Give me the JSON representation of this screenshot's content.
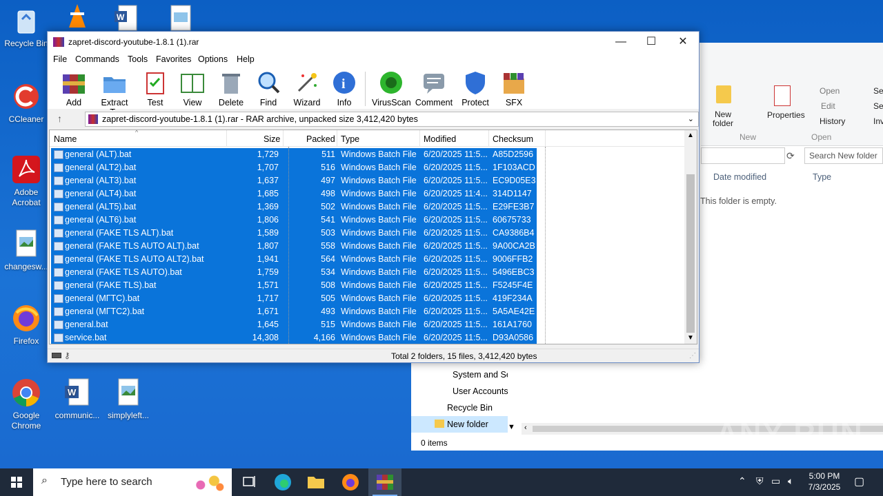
{
  "desktop": {
    "icons": [
      {
        "label": "Recycle Bin"
      },
      {
        "label": "CCleaner"
      },
      {
        "label": "Adobe Acrobat"
      },
      {
        "label": "changesw..."
      },
      {
        "label": "Firefox"
      },
      {
        "label": "Google Chrome"
      },
      {
        "label": "communic..."
      },
      {
        "label": "simplyleft..."
      }
    ]
  },
  "explorer": {
    "ribbon": {
      "new_folder": "New folder",
      "new_group": "New",
      "properties": "Properties",
      "open": "Open",
      "edit": "Edit",
      "history": "History",
      "open_group": "Open",
      "sel1": "Sel",
      "sel2": "Sel",
      "inv": "Inv"
    },
    "search_placeholder": "Search New folder",
    "col_date": "Date modified",
    "col_type": "Type",
    "empty_msg": "This folder is empty.",
    "nav": [
      {
        "label": "System and Se"
      },
      {
        "label": "User Accounts"
      },
      {
        "label": "Recycle Bin"
      },
      {
        "label": "New folder"
      }
    ],
    "status": "0 items"
  },
  "winrar": {
    "title": "zapret-discord-youtube-1.8.1 (1).rar",
    "menu": [
      "File",
      "Commands",
      "Tools",
      "Favorites",
      "Options",
      "Help"
    ],
    "toolbar": [
      "Add",
      "Extract To",
      "Test",
      "View",
      "Delete",
      "Find",
      "Wizard",
      "Info",
      "VirusScan",
      "Comment",
      "Protect",
      "SFX"
    ],
    "address": "zapret-discord-youtube-1.8.1 (1).rar - RAR archive, unpacked size 3,412,420 bytes",
    "columns": {
      "name": "Name",
      "size": "Size",
      "packed": "Packed",
      "type": "Type",
      "modified": "Modified",
      "checksum": "Checksum"
    },
    "files": [
      {
        "name": "general (ALT).bat",
        "size": "1,729",
        "packed": "511",
        "type": "Windows Batch File",
        "modified": "6/20/2025 11:5...",
        "checksum": "A85D2596"
      },
      {
        "name": "general (ALT2).bat",
        "size": "1,707",
        "packed": "516",
        "type": "Windows Batch File",
        "modified": "6/20/2025 11:5...",
        "checksum": "1F103ACD"
      },
      {
        "name": "general (ALT3).bat",
        "size": "1,637",
        "packed": "497",
        "type": "Windows Batch File",
        "modified": "6/20/2025 11:5...",
        "checksum": "EC9D05E3"
      },
      {
        "name": "general (ALT4).bat",
        "size": "1,685",
        "packed": "498",
        "type": "Windows Batch File",
        "modified": "6/20/2025 11:4...",
        "checksum": "314D1147"
      },
      {
        "name": "general (ALT5).bat",
        "size": "1,369",
        "packed": "502",
        "type": "Windows Batch File",
        "modified": "6/20/2025 11:5...",
        "checksum": "E29FE3B7"
      },
      {
        "name": "general (ALT6).bat",
        "size": "1,806",
        "packed": "541",
        "type": "Windows Batch File",
        "modified": "6/20/2025 11:5...",
        "checksum": "60675733"
      },
      {
        "name": "general (FAKE TLS ALT).bat",
        "size": "1,589",
        "packed": "503",
        "type": "Windows Batch File",
        "modified": "6/20/2025 11:5...",
        "checksum": "CA9386B4"
      },
      {
        "name": "general (FAKE TLS AUTO ALT).bat",
        "size": "1,807",
        "packed": "558",
        "type": "Windows Batch File",
        "modified": "6/20/2025 11:5...",
        "checksum": "9A00CA2B"
      },
      {
        "name": "general (FAKE TLS AUTO ALT2).bat",
        "size": "1,941",
        "packed": "564",
        "type": "Windows Batch File",
        "modified": "6/20/2025 11:5...",
        "checksum": "9006FFB2"
      },
      {
        "name": "general (FAKE TLS AUTO).bat",
        "size": "1,759",
        "packed": "534",
        "type": "Windows Batch File",
        "modified": "6/20/2025 11:5...",
        "checksum": "5496EBC3"
      },
      {
        "name": "general (FAKE TLS).bat",
        "size": "1,571",
        "packed": "508",
        "type": "Windows Batch File",
        "modified": "6/20/2025 11:5...",
        "checksum": "F5245F4E"
      },
      {
        "name": "general (МГТС).bat",
        "size": "1,717",
        "packed": "505",
        "type": "Windows Batch File",
        "modified": "6/20/2025 11:5...",
        "checksum": "419F234A"
      },
      {
        "name": "general (МГТС2).bat",
        "size": "1,671",
        "packed": "493",
        "type": "Windows Batch File",
        "modified": "6/20/2025 11:5...",
        "checksum": "5A5AE42E"
      },
      {
        "name": "general.bat",
        "size": "1,645",
        "packed": "515",
        "type": "Windows Batch File",
        "modified": "6/20/2025 11:5...",
        "checksum": "161A1760"
      },
      {
        "name": "service.bat",
        "size": "14,308",
        "packed": "4,166",
        "type": "Windows Batch File",
        "modified": "6/20/2025 11:5...",
        "checksum": "D93A0586"
      }
    ],
    "status": "Total 2 folders, 15 files, 3,412,420 bytes"
  },
  "taskbar": {
    "search_placeholder": "Type here to search",
    "time": "5:00 PM",
    "date": "7/3/2025"
  },
  "watermark": "ANY RUN",
  "colors": {
    "selection": "#0a74da",
    "desktop": "#1565c9",
    "taskbar": "#1f2a3a"
  }
}
